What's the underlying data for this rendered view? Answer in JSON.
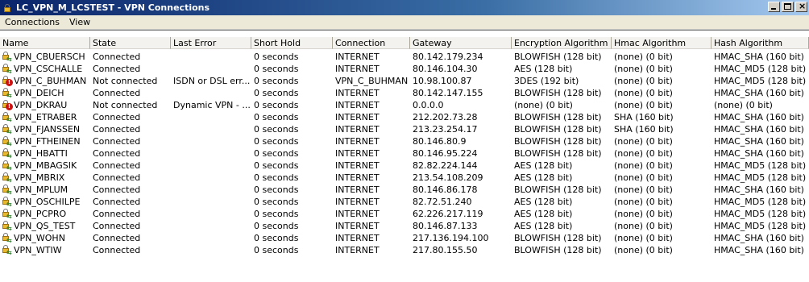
{
  "window": {
    "title": "LC_VPN_M_LCSTEST - VPN Connections",
    "controls": [
      "_",
      "□",
      "×"
    ]
  },
  "menu": [
    "Connections",
    "View"
  ],
  "columns": [
    {
      "label": "Name"
    },
    {
      "label": "State"
    },
    {
      "label": "Last Error"
    },
    {
      "label": "Short Hold"
    },
    {
      "label": "Connection"
    },
    {
      "label": "Gateway"
    },
    {
      "label": "Encryption Algorithm"
    },
    {
      "label": "Hmac Algorithm"
    },
    {
      "label": "Hash Algorithm"
    }
  ],
  "rows": [
    {
      "icon": "connected",
      "name": "VPN_CBUERSCH",
      "state": "Connected",
      "error": "",
      "hold": "0 seconds",
      "conn": "INTERNET",
      "gw": "80.142.179.234",
      "enc": "BLOWFISH (128 bit)",
      "hmac": "(none) (0 bit)",
      "hash": "HMAC_SHA (160 bit)"
    },
    {
      "icon": "connected",
      "name": "VPN_CSCHALLE",
      "state": "Connected",
      "error": "",
      "hold": "0 seconds",
      "conn": "INTERNET",
      "gw": "80.146.104.30",
      "enc": "AES (128 bit)",
      "hmac": "(none) (0 bit)",
      "hash": "HMAC_MD5 (128 bit)"
    },
    {
      "icon": "error",
      "name": "VPN_C_BUHMAN",
      "state": "Not connected",
      "error": "ISDN or DSL err...",
      "hold": "0 seconds",
      "conn": "VPN_C_BUHMAN",
      "gw": "10.98.100.87",
      "enc": "3DES (192 bit)",
      "hmac": "(none) (0 bit)",
      "hash": "HMAC_MD5 (128 bit)"
    },
    {
      "icon": "connected",
      "name": "VPN_DEICH",
      "state": "Connected",
      "error": "",
      "hold": "0 seconds",
      "conn": "INTERNET",
      "gw": "80.142.147.155",
      "enc": "BLOWFISH (128 bit)",
      "hmac": "(none) (0 bit)",
      "hash": "HMAC_SHA (160 bit)"
    },
    {
      "icon": "error",
      "name": "VPN_DKRAU",
      "state": "Not connected",
      "error": "Dynamic VPN - ...",
      "hold": "0 seconds",
      "conn": "INTERNET",
      "gw": "0.0.0.0",
      "enc": "(none) (0 bit)",
      "hmac": "(none) (0 bit)",
      "hash": "(none) (0 bit)"
    },
    {
      "icon": "connected",
      "name": "VPN_ETRABER",
      "state": "Connected",
      "error": "",
      "hold": "0 seconds",
      "conn": "INTERNET",
      "gw": "212.202.73.28",
      "enc": "BLOWFISH (128 bit)",
      "hmac": "SHA (160 bit)",
      "hash": "HMAC_SHA (160 bit)"
    },
    {
      "icon": "connected",
      "name": "VPN_FJANSSEN",
      "state": "Connected",
      "error": "",
      "hold": "0 seconds",
      "conn": "INTERNET",
      "gw": "213.23.254.17",
      "enc": "BLOWFISH (128 bit)",
      "hmac": "SHA (160 bit)",
      "hash": "HMAC_SHA (160 bit)"
    },
    {
      "icon": "connected",
      "name": "VPN_FTHEINEN",
      "state": "Connected",
      "error": "",
      "hold": "0 seconds",
      "conn": "INTERNET",
      "gw": "80.146.80.9",
      "enc": "BLOWFISH (128 bit)",
      "hmac": "(none) (0 bit)",
      "hash": "HMAC_SHA (160 bit)"
    },
    {
      "icon": "connected",
      "name": "VPN_HBATTI",
      "state": "Connected",
      "error": "",
      "hold": "0 seconds",
      "conn": "INTERNET",
      "gw": "80.146.95.224",
      "enc": "BLOWFISH (128 bit)",
      "hmac": "(none) (0 bit)",
      "hash": "HMAC_SHA (160 bit)"
    },
    {
      "icon": "connected",
      "name": "VPN_MBAGSIK",
      "state": "Connected",
      "error": "",
      "hold": "0 seconds",
      "conn": "INTERNET",
      "gw": "82.82.224.144",
      "enc": "AES (128 bit)",
      "hmac": "(none) (0 bit)",
      "hash": "HMAC_MD5 (128 bit)"
    },
    {
      "icon": "connected",
      "name": "VPN_MBRIX",
      "state": "Connected",
      "error": "",
      "hold": "0 seconds",
      "conn": "INTERNET",
      "gw": "213.54.108.209",
      "enc": "AES (128 bit)",
      "hmac": "(none) (0 bit)",
      "hash": "HMAC_MD5 (128 bit)"
    },
    {
      "icon": "connected",
      "name": "VPN_MPLUM",
      "state": "Connected",
      "error": "",
      "hold": "0 seconds",
      "conn": "INTERNET",
      "gw": "80.146.86.178",
      "enc": "BLOWFISH (128 bit)",
      "hmac": "(none) (0 bit)",
      "hash": "HMAC_SHA (160 bit)"
    },
    {
      "icon": "connected",
      "name": "VPN_OSCHILPE",
      "state": "Connected",
      "error": "",
      "hold": "0 seconds",
      "conn": "INTERNET",
      "gw": "82.72.51.240",
      "enc": "AES (128 bit)",
      "hmac": "(none) (0 bit)",
      "hash": "HMAC_MD5 (128 bit)"
    },
    {
      "icon": "connected",
      "name": "VPN_PCPRO",
      "state": "Connected",
      "error": "",
      "hold": "0 seconds",
      "conn": "INTERNET",
      "gw": "62.226.217.119",
      "enc": "AES (128 bit)",
      "hmac": "(none) (0 bit)",
      "hash": "HMAC_MD5 (128 bit)"
    },
    {
      "icon": "connected",
      "name": "VPN_QS_TEST",
      "state": "Connected",
      "error": "",
      "hold": "0 seconds",
      "conn": "INTERNET",
      "gw": "80.146.87.133",
      "enc": "AES (128 bit)",
      "hmac": "(none) (0 bit)",
      "hash": "HMAC_MD5 (128 bit)"
    },
    {
      "icon": "connected",
      "name": "VPN_WOHN",
      "state": "Connected",
      "error": "",
      "hold": "0 seconds",
      "conn": "INTERNET",
      "gw": "217.136.194.100",
      "enc": "BLOWFISH (128 bit)",
      "hmac": "(none) (0 bit)",
      "hash": "HMAC_SHA (160 bit)"
    },
    {
      "icon": "connected",
      "name": "VPN_WTIW",
      "state": "Connected",
      "error": "",
      "hold": "0 seconds",
      "conn": "INTERNET",
      "gw": "217.80.155.50",
      "enc": "BLOWFISH (128 bit)",
      "hmac": "(none) (0 bit)",
      "hash": "HMAC_SHA (160 bit)"
    }
  ]
}
